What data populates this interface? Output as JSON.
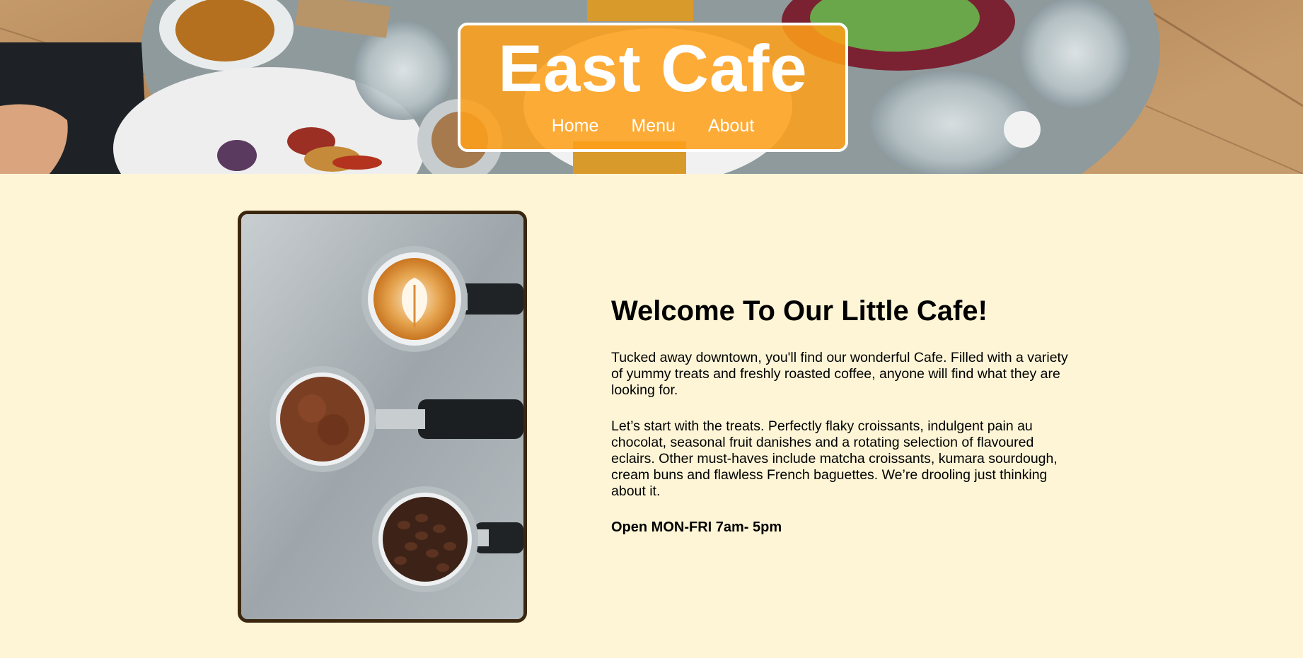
{
  "site": {
    "title": "East Cafe",
    "nav": [
      {
        "label": "Home"
      },
      {
        "label": "Menu"
      },
      {
        "label": "About"
      }
    ]
  },
  "hero_image": {
    "icon": "overhead-table-with-coffee-and-waffles-photo"
  },
  "feature_image": {
    "icon": "espresso-portafilters-latte-grounds-beans-photo"
  },
  "intro": {
    "heading": "Welcome To Our Little Cafe!",
    "paragraph_1": "Tucked away downtown, you'll find our wonderful Cafe. Filled with a variety of yummy treats and freshly roasted coffee, anyone will find what they are looking for.",
    "paragraph_2": "Let’s start with the treats. Perfectly flaky croissants, indulgent pain au chocolat, seasonal fruit danishes and a rotating selection of flavoured eclairs. Other must-haves include matcha croissants, kumara sourdough, cream buns and flawless French baguettes. We’re drooling just thinking about it.",
    "hours": "Open MON-FRI 7am- 5pm"
  },
  "colors": {
    "page_background": "#fdf5d6",
    "brand_orange": "#ffa019",
    "frame_brown": "#3b2710"
  }
}
